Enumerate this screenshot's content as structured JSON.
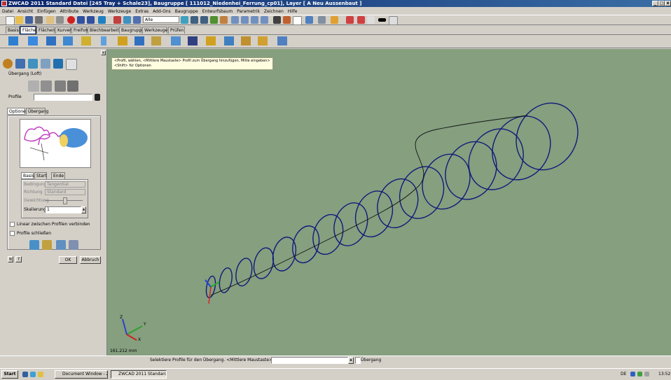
{
  "window": {
    "title": "ZWCAD 2011 Standard        Datei [245 Tray + Schale23], Baugruppe [ 111012_Niedenhei_Ferrung_cp01], Layer [ A Neu Aussenbaut ]",
    "minimize": "_",
    "maximize": "□",
    "close": "x"
  },
  "menu": [
    "Datei",
    "Ansicht",
    "Einfügen",
    "Attribute",
    "Werkzeug",
    "Werkzeuge",
    "Extras",
    "Add-Ons",
    "Baugruppe",
    "Entwurfsbaum",
    "Parametrik",
    "Zeichnen",
    "Hilfe"
  ],
  "toolbar2": {
    "layer_combo": "Alle"
  },
  "ribbon_tabs": [
    "Basis",
    "Fläche",
    "Flächen",
    "Kurven",
    "Freiform",
    "Blechbearbeitung",
    "Baugruppe",
    "Werkzeuge",
    "Prüfen"
  ],
  "ribbon_active_tab": "Fläche",
  "panel": {
    "title": "Übergang (Loft)",
    "profile_label": "Profile",
    "tabs": [
      "Optionen",
      "Übergang"
    ],
    "subtabs": [
      "Basis",
      "Start",
      "Ende"
    ],
    "rows": [
      {
        "label": "Bedingung",
        "value": "Tangential"
      },
      {
        "label": "Richtung",
        "value": "Standard"
      },
      {
        "label": "Gewichtung",
        "value": ""
      },
      {
        "label": "Skalierung",
        "value": "1"
      }
    ],
    "checkbox1": "Linear zwischen Profilen verbinden",
    "checkbox2": "Profile schließen",
    "ok": "OK",
    "cancel": "Abbruch"
  },
  "viewport": {
    "hint_line1": "<Profil, wählen, <Mittlere Maustaste> Profil zum Übergang hinzufügen, Mitte eingeben>",
    "hint_line2": "<Shift> für Optionen",
    "scale": "161.212 mm",
    "axis_x": "X",
    "axis_y": "Y",
    "axis_z": "Z"
  },
  "statusbar": {
    "prompt": "Selektiere Profile für den Übergang. <Mittlere Maustaste> zum Beenden",
    "dropdown": "Übergang"
  },
  "taskbar": {
    "start": "Start",
    "tasks": [
      "Document Window - ZW3...",
      "ZWCAD 2011 Standard ..."
    ],
    "lang": "DE",
    "clock": "13:52"
  },
  "colors": {
    "viewport": "#859f7f",
    "curve": "#101a7a",
    "titlebar": "#0a246a"
  }
}
